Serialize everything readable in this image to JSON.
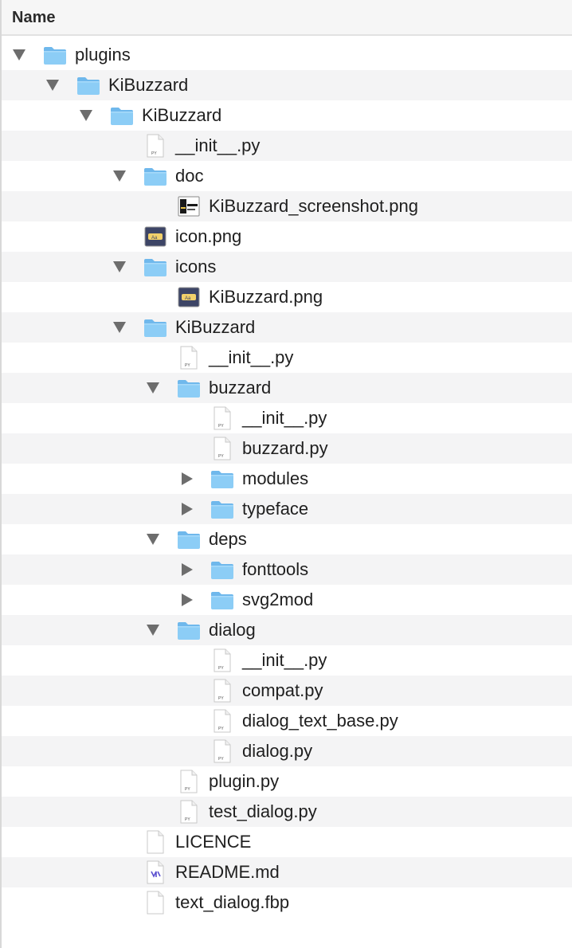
{
  "header": {
    "name_label": "Name"
  },
  "rows": [
    {
      "label": "plugins",
      "level": 0,
      "kind": "folder",
      "state": "open"
    },
    {
      "label": "KiBuzzard",
      "level": 1,
      "kind": "folder",
      "state": "open"
    },
    {
      "label": "KiBuzzard",
      "level": 2,
      "kind": "folder",
      "state": "open"
    },
    {
      "label": "__init__.py",
      "level": 3,
      "kind": "py"
    },
    {
      "label": "doc",
      "level": 3,
      "kind": "folder",
      "state": "open"
    },
    {
      "label": "KiBuzzard_screenshot.png",
      "level": 4,
      "kind": "screenshot-img"
    },
    {
      "label": "icon.png",
      "level": 3,
      "kind": "image"
    },
    {
      "label": "icons",
      "level": 3,
      "kind": "folder",
      "state": "open"
    },
    {
      "label": "KiBuzzard.png",
      "level": 4,
      "kind": "image"
    },
    {
      "label": "KiBuzzard",
      "level": 3,
      "kind": "folder",
      "state": "open"
    },
    {
      "label": "__init__.py",
      "level": 4,
      "kind": "py"
    },
    {
      "label": "buzzard",
      "level": 4,
      "kind": "folder",
      "state": "open"
    },
    {
      "label": "__init__.py",
      "level": 5,
      "kind": "py"
    },
    {
      "label": "buzzard.py",
      "level": 5,
      "kind": "py"
    },
    {
      "label": "modules",
      "level": 5,
      "kind": "folder",
      "state": "closed"
    },
    {
      "label": "typeface",
      "level": 5,
      "kind": "folder",
      "state": "closed"
    },
    {
      "label": "deps",
      "level": 4,
      "kind": "folder",
      "state": "open"
    },
    {
      "label": "fonttools",
      "level": 5,
      "kind": "folder",
      "state": "closed"
    },
    {
      "label": "svg2mod",
      "level": 5,
      "kind": "folder",
      "state": "closed"
    },
    {
      "label": "dialog",
      "level": 4,
      "kind": "folder",
      "state": "open"
    },
    {
      "label": "__init__.py",
      "level": 5,
      "kind": "py"
    },
    {
      "label": "compat.py",
      "level": 5,
      "kind": "py"
    },
    {
      "label": "dialog_text_base.py",
      "level": 5,
      "kind": "py"
    },
    {
      "label": "dialog.py",
      "level": 5,
      "kind": "py"
    },
    {
      "label": "plugin.py",
      "level": 4,
      "kind": "py"
    },
    {
      "label": "test_dialog.py",
      "level": 4,
      "kind": "py"
    },
    {
      "label": "LICENCE",
      "level": 3,
      "kind": "blank"
    },
    {
      "label": "README.md",
      "level": 3,
      "kind": "markdown"
    },
    {
      "label": "text_dialog.fbp",
      "level": 3,
      "kind": "blank"
    }
  ],
  "colors": {
    "folder_body": "#8ccdf6",
    "folder_tab": "#6fb8ec",
    "row_alt": "#f4f4f5"
  },
  "icon_names": {
    "folder": "folder-icon",
    "py": "python-file-icon",
    "image": "image-file-icon",
    "screenshot-img": "screenshot-file-icon",
    "blank": "document-icon",
    "markdown": "markdown-file-icon"
  }
}
